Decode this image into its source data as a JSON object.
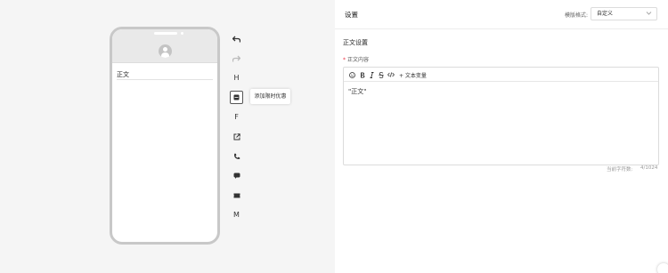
{
  "phone": {
    "body_text": "正文"
  },
  "toolbar": {
    "items": [
      {
        "name": "undo",
        "label": ""
      },
      {
        "name": "redo",
        "label": ""
      },
      {
        "name": "header",
        "label": "H"
      },
      {
        "name": "coupon",
        "label": ""
      },
      {
        "name": "footer",
        "label": "F"
      },
      {
        "name": "link",
        "label": ""
      },
      {
        "name": "phone",
        "label": ""
      },
      {
        "name": "message",
        "label": ""
      },
      {
        "name": "ticket",
        "label": ""
      },
      {
        "name": "menu",
        "label": "M"
      }
    ],
    "tooltip": "添加限时优惠"
  },
  "right": {
    "title": "设置",
    "format_label": "模版格式:",
    "format_value": "自定义",
    "section_title": "正文设置",
    "field_label": "正文内容",
    "required_mark": "*",
    "editor": {
      "text_variable_label": "+ 文本变量",
      "content": "\"正文\""
    },
    "counter_label": "当前字符数:",
    "counter_value": "4/1024"
  }
}
